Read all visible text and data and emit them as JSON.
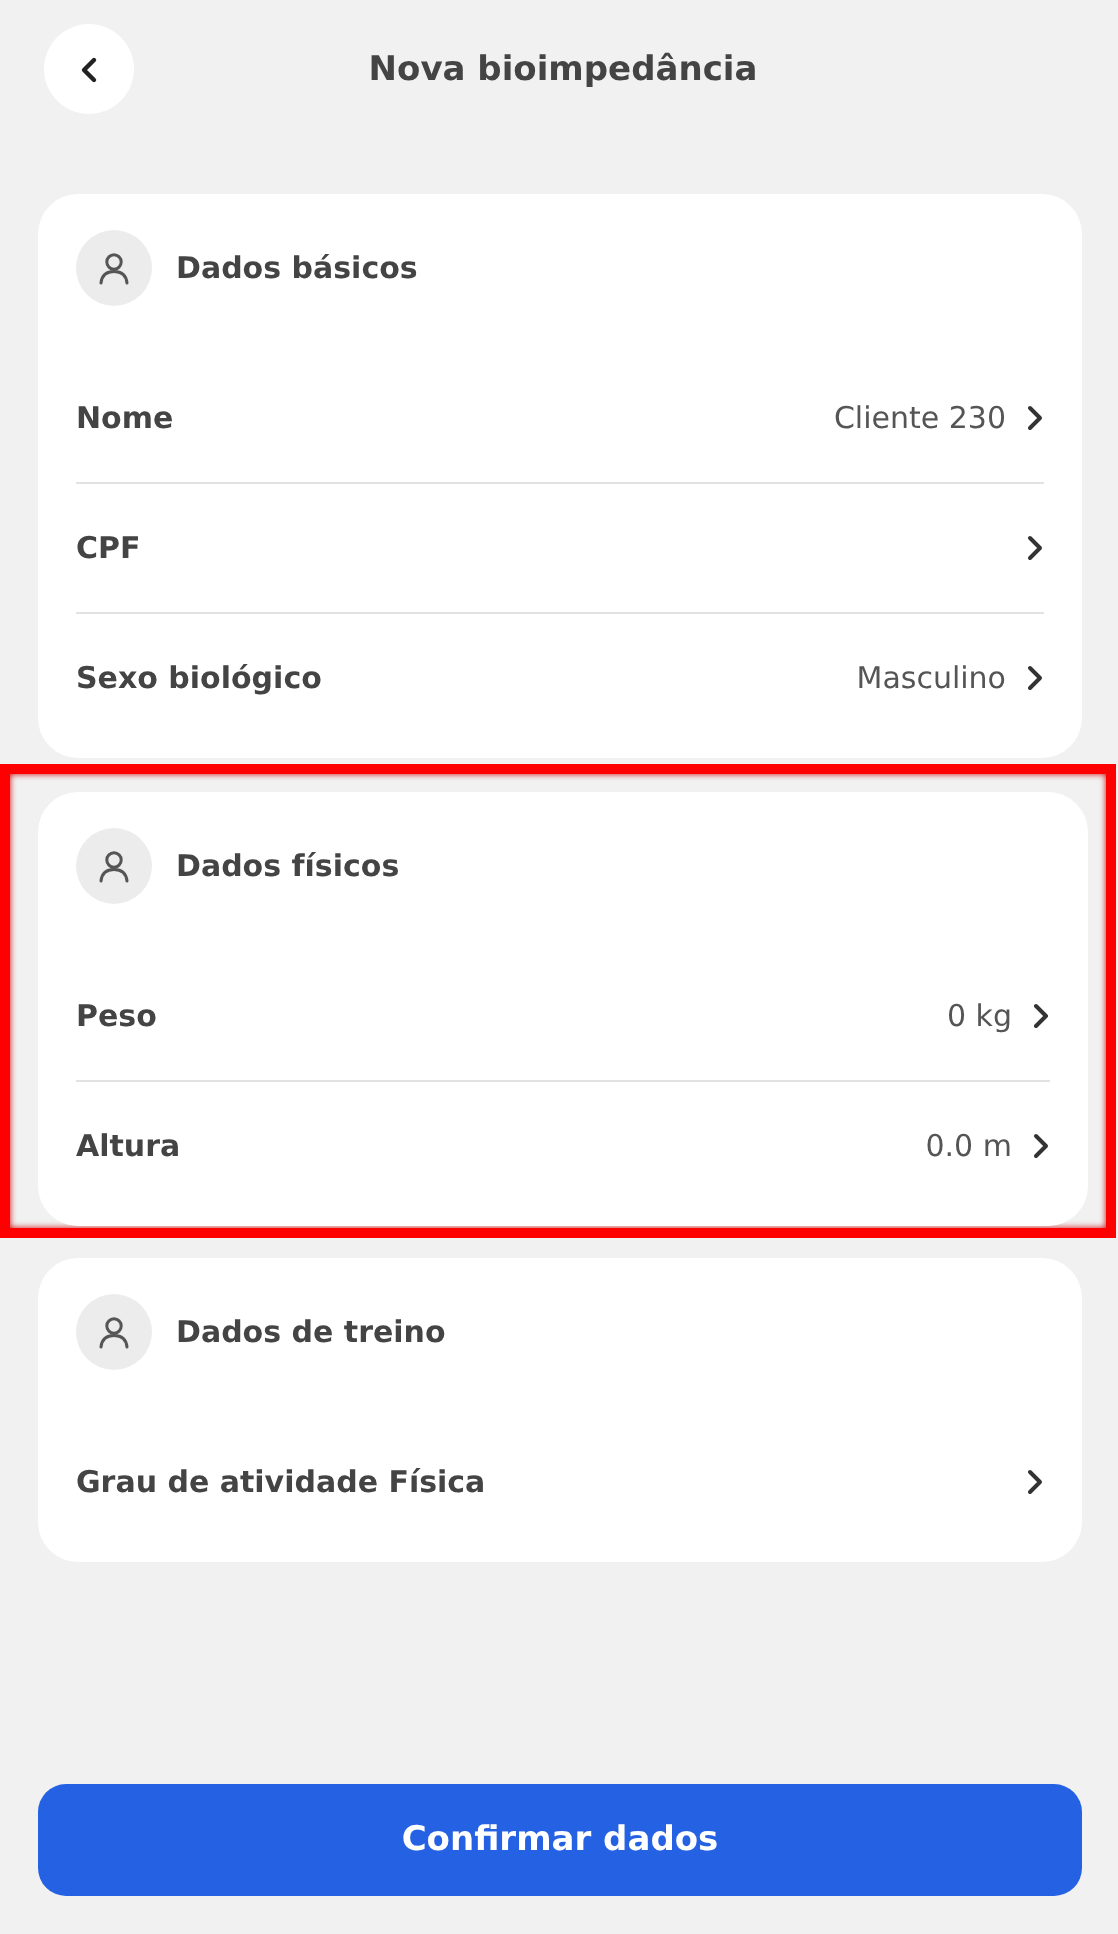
{
  "header": {
    "title": "Nova bioimpedância"
  },
  "sections": [
    {
      "title": "Dados básicos",
      "highlighted": false,
      "rows": [
        {
          "label": "Nome",
          "value": "Cliente 230"
        },
        {
          "label": "CPF"
        },
        {
          "label": "Sexo biológico",
          "value": "Masculino"
        }
      ]
    },
    {
      "title": "Dados físicos",
      "highlighted": true,
      "rows": [
        {
          "label": "Peso",
          "value": "0 kg"
        },
        {
          "label": "Altura",
          "value": "0.0 m"
        }
      ]
    },
    {
      "title": "Dados de treino",
      "highlighted": false,
      "rows": [
        {
          "label": "Grau de atividade Física"
        }
      ]
    }
  ],
  "confirm_button": "Confirmar dados"
}
